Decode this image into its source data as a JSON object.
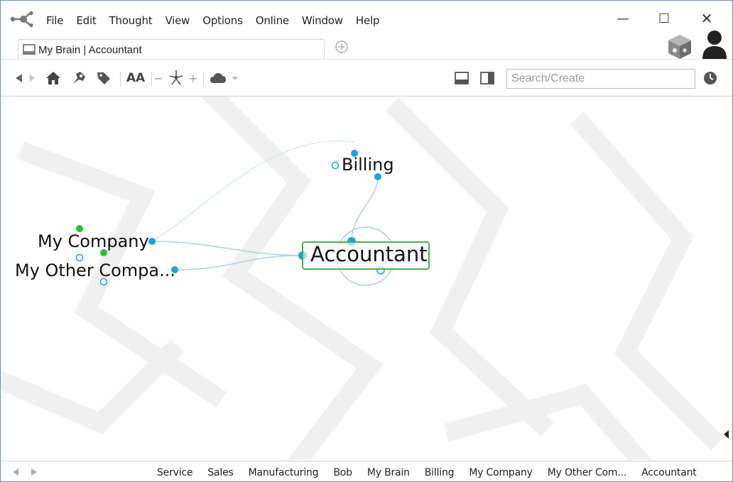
{
  "window": {
    "menu": [
      "File",
      "Edit",
      "Thought",
      "View",
      "Options",
      "Online",
      "Window",
      "Help"
    ],
    "controls": {
      "minimize": "—",
      "maximize": "☐",
      "close": "✕"
    }
  },
  "tab": {
    "label": "My Brain | Accountant"
  },
  "toolbar": {
    "search_placeholder": "Search/Create",
    "font_size_label": "AA",
    "zoom_minus": "−",
    "zoom_plus": "+"
  },
  "thoughts": {
    "active": "Accountant",
    "child": "Billing",
    "jumps": [
      "My Company",
      "My Other Compa..."
    ]
  },
  "history": {
    "items": [
      "Service",
      "Sales",
      "Manufacturing",
      "Bob",
      "My Brain",
      "Billing",
      "My Company",
      "My Other Com...",
      "Accountant"
    ]
  },
  "colors": {
    "accent_node": "#1aa3e0",
    "parent_node": "#2cbf2c",
    "active_border": "#4caf50",
    "link_line": "#a9d4e4",
    "window_border": "#6a8fc4"
  },
  "icons": [
    "app-logo-icon",
    "tab-brain-icon",
    "add-tab-icon",
    "brain-cube-icon",
    "user-icon",
    "back-icon",
    "forward-icon",
    "home-icon",
    "pin-icon",
    "tag-icon",
    "gravity-icon",
    "cloud-icon",
    "layout-bottom-icon",
    "layout-right-icon",
    "history-clock-icon"
  ]
}
